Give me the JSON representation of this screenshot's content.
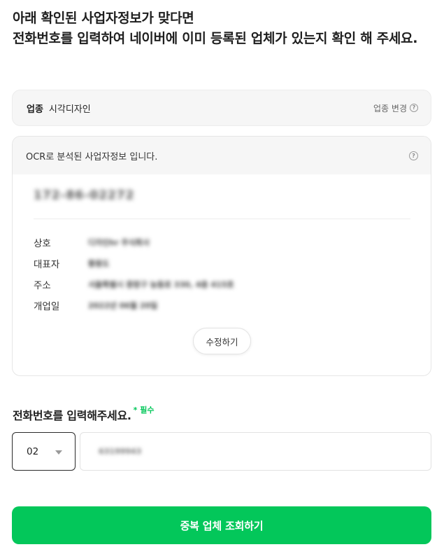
{
  "headline": {
    "line1": "아래 확인된 사업자정보가 맞다면",
    "line2": "전화번호를 입력하여 네이버에 이미 등록된 업체가 있는지 확인 해 주세요."
  },
  "industry": {
    "label": "업종",
    "value": "시각디자인",
    "change_label": "업종 변경",
    "help_icon": "question-circle"
  },
  "ocr": {
    "header": "OCR로 분석된 사업자정보 입니다.",
    "help_icon": "question-circle",
    "business_number": "172-86-02272",
    "rows": [
      {
        "label": "상호",
        "value": "디자인hr 주식회사"
      },
      {
        "label": "대표자",
        "value": "황용도"
      },
      {
        "label": "주소",
        "value": "서울특별시 중랑구 능동로 330, 4층 415호"
      },
      {
        "label": "개업일",
        "value": "2022년 06월 20일"
      }
    ],
    "edit_button": "수정하기"
  },
  "phone": {
    "title": "전화번호를 입력해주세요.",
    "required": "* 필수",
    "area_code": "02",
    "number": "63199943"
  },
  "submit_button": "중복 업체 조회하기",
  "colors": {
    "accent": "#03c75a",
    "card_bg": "#f6f6f6"
  }
}
